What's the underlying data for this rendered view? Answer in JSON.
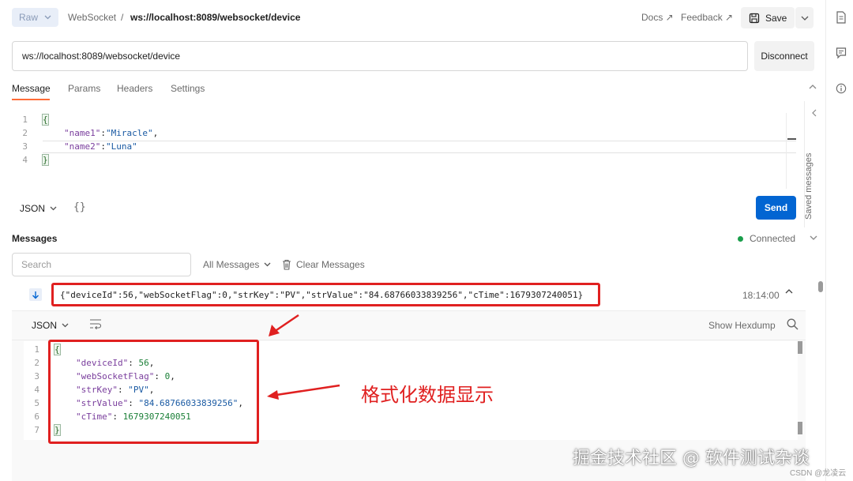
{
  "header": {
    "request_type": "Raw",
    "protocol": "WebSocket",
    "separator": "/",
    "url_title": "ws://localhost:8089/websocket/device",
    "docs_label": "Docs ↗",
    "feedback_label": "Feedback ↗",
    "save_label": "Save"
  },
  "url_bar": {
    "value": "ws://localhost:8089/websocket/device",
    "disconnect_label": "Disconnect"
  },
  "tabs": [
    {
      "label": "Message",
      "active": true
    },
    {
      "label": "Params",
      "active": false
    },
    {
      "label": "Headers",
      "active": false
    },
    {
      "label": "Settings",
      "active": false
    }
  ],
  "editor": {
    "line_numbers": [
      "1",
      "2",
      "3",
      "4"
    ],
    "open_brace": "{",
    "close_brace": "}",
    "key1": "\"name1\"",
    "val1": "\"Miracle\"",
    "key2": "\"name2\"",
    "val2": "\"Luna\"",
    "format": "JSON",
    "beautify_label": "{}",
    "send_label": "Send",
    "saved_messages_label": "Saved messages"
  },
  "messages": {
    "title": "Messages",
    "status": "Connected",
    "search_placeholder": "Search",
    "filter_label": "All Messages",
    "clear_label": "Clear Messages",
    "items": [
      {
        "text": "{\"deviceId\":56,\"webSocketFlag\":0,\"strKey\":\"PV\",\"strValue\":\"84.68766033839256\",\"cTime\":1679307240051}",
        "time": "18:14:00"
      }
    ]
  },
  "expanded": {
    "format": "JSON",
    "hexdump_label": "Show Hexdump",
    "line_numbers": [
      "1",
      "2",
      "3",
      "4",
      "5",
      "6",
      "7"
    ],
    "open_brace": "{",
    "close_brace": "}",
    "fields": [
      {
        "key": "\"deviceId\"",
        "value": "56",
        "kind": "num",
        "comma": ","
      },
      {
        "key": "\"webSocketFlag\"",
        "value": "0",
        "kind": "num",
        "comma": ","
      },
      {
        "key": "\"strKey\"",
        "value": "\"PV\"",
        "kind": "str",
        "comma": ","
      },
      {
        "key": "\"strValue\"",
        "value": "\"84.68766033839256\"",
        "kind": "str",
        "comma": ","
      },
      {
        "key": "\"cTime\"",
        "value": "1679307240051",
        "kind": "num",
        "comma": ""
      }
    ]
  },
  "annotation": {
    "label": "格式化数据显示"
  },
  "watermark": {
    "text": "掘金技术社区 @ 软件测试杂谈",
    "credit": "CSDN @龙凌云"
  },
  "colors": {
    "accent": "#ff6c37",
    "send": "#0265d2",
    "annotation_red": "#e02020",
    "connected": "#1a9e4b"
  }
}
